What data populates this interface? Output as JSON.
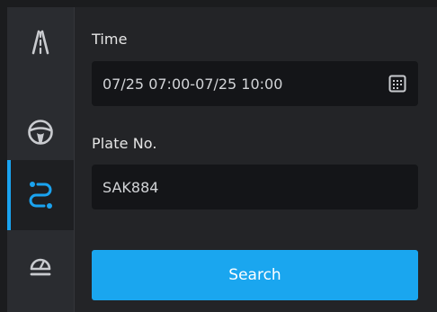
{
  "sidebar": {
    "items": [
      {
        "icon": "road-lanes-icon",
        "active": false
      },
      {
        "icon": "steering-wheel-icon",
        "active": false
      },
      {
        "icon": "route-icon",
        "active": true
      },
      {
        "icon": "speed-alarm-icon",
        "active": false
      }
    ],
    "accent_color": "#1aa3f0"
  },
  "form": {
    "time_label": "Time",
    "time_value": "07/25 07:00-07/25 10:00",
    "calendar_icon": "calendar-icon",
    "plate_label": "Plate No.",
    "plate_value": "SAK884",
    "search_label": "Search",
    "button_color": "#1aa6ef"
  }
}
